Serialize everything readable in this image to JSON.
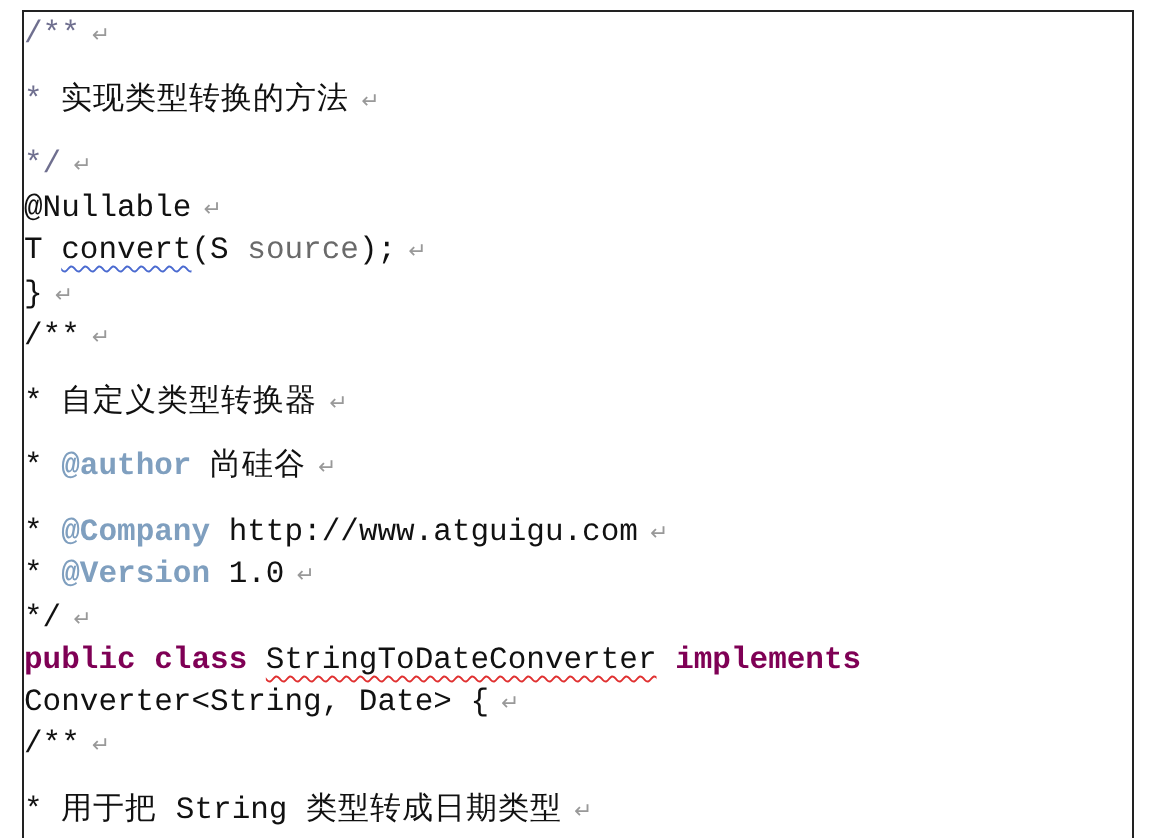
{
  "document": {
    "lines": [
      {
        "prose": false,
        "segments": [
          {
            "text": "/**",
            "color": "#6f6f8f"
          }
        ],
        "mark": "↵"
      },
      {
        "prose": true,
        "segments": [
          {
            "text": "* ",
            "color": "#6f6f8f"
          },
          {
            "text": "实现类型转换的方法"
          }
        ],
        "mark": "↵"
      },
      {
        "prose": true,
        "segments": [
          {
            "text": "*/",
            "color": "#6f6f8f"
          }
        ],
        "mark": "↵"
      },
      {
        "prose": false,
        "segments": [
          {
            "text": "@Nullable"
          }
        ],
        "mark": "↵"
      },
      {
        "prose": false,
        "segments": [
          {
            "text": "T "
          },
          {
            "text": "convert",
            "grammar_error": true
          },
          {
            "text": "(S "
          },
          {
            "text": "source",
            "color": "#6a6a6a"
          },
          {
            "text": ");"
          }
        ],
        "mark": "↵"
      },
      {
        "prose": false,
        "segments": [
          {
            "text": "}"
          }
        ],
        "mark": "↵"
      },
      {
        "prose": false,
        "segments": [
          {
            "text": "/**"
          }
        ],
        "mark": "↵"
      },
      {
        "prose": true,
        "segments": [
          {
            "text": "* "
          },
          {
            "text": "自定义类型转换器"
          }
        ],
        "mark": "↵"
      },
      {
        "prose": true,
        "segments": [
          {
            "text": "* "
          },
          {
            "text": "@author",
            "bold": true,
            "color": "#7f9fbf"
          },
          {
            "text": " 尚硅谷"
          }
        ],
        "mark": "↵"
      },
      {
        "prose": true,
        "segments": [
          {
            "text": "* "
          },
          {
            "text": "@Company",
            "bold": true,
            "color": "#7f9fbf"
          },
          {
            "text": " http://www.atguigu.com"
          }
        ],
        "mark": "↵"
      },
      {
        "prose": false,
        "segments": [
          {
            "text": "* "
          },
          {
            "text": "@Version",
            "bold": true,
            "color": "#7f9fbf"
          },
          {
            "text": " 1.0"
          }
        ],
        "mark": "↵"
      },
      {
        "prose": false,
        "segments": [
          {
            "text": "*/"
          }
        ],
        "mark": "↵"
      },
      {
        "prose": false,
        "segments": [
          {
            "text": "public class ",
            "bold": true,
            "color": "#7f0055"
          },
          {
            "text": "StringToDateConverter",
            "spelling_error": true
          },
          {
            "text": " implements",
            "bold": true,
            "color": "#7f0055"
          }
        ]
      },
      {
        "prose": false,
        "segments": [
          {
            "text": "Converter<String, Date> {"
          }
        ],
        "mark": "↵"
      },
      {
        "prose": false,
        "segments": [
          {
            "text": "/**"
          }
        ],
        "mark": "↵"
      },
      {
        "prose": true,
        "segments": [
          {
            "text": "* "
          },
          {
            "text": "用于把 String 类型转成日期类型"
          }
        ],
        "mark": "↵"
      }
    ]
  }
}
